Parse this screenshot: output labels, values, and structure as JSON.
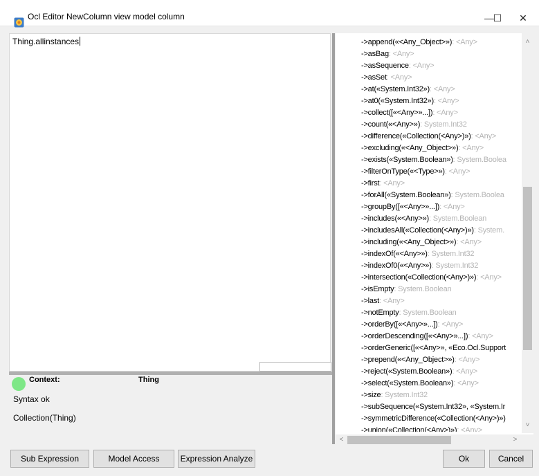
{
  "window": {
    "title": "Ocl Editor NewColumn view model column",
    "controls": {
      "minimize": "—",
      "maximize": "☐",
      "close": "✕"
    }
  },
  "editor": {
    "text": "Thing.allinstances"
  },
  "info": {
    "context_label": "Context:",
    "context_value": "Thing",
    "syntax_status": "Syntax ok",
    "result_type": "Collection(Thing)",
    "status_color": "#7ee787"
  },
  "completion": {
    "items": [
      {
        "name": "->append(«<Any_Object>»)",
        "type": "<Any>"
      },
      {
        "name": "->asBag",
        "type": "<Any>"
      },
      {
        "name": "->asSequence",
        "type": "<Any>"
      },
      {
        "name": "->asSet",
        "type": "<Any>"
      },
      {
        "name": "->at(«System.Int32»)",
        "type": "<Any>"
      },
      {
        "name": "->at0(«System.Int32»)",
        "type": "<Any>"
      },
      {
        "name": "->collect([«<Any>»...])",
        "type": "<Any>"
      },
      {
        "name": "->count(«<Any>»)",
        "type": "System.Int32"
      },
      {
        "name": "->difference(«Collection(<Any>)»)",
        "type": "<Any>"
      },
      {
        "name": "->excluding(«<Any_Object>»)",
        "type": "<Any>"
      },
      {
        "name": "->exists(«System.Boolean»)",
        "type": "System.Boolea"
      },
      {
        "name": "->filterOnType(«<Type>»)",
        "type": "<Any>"
      },
      {
        "name": "->first",
        "type": "<Any>"
      },
      {
        "name": "->forAll(«System.Boolean»)",
        "type": "System.Boolea"
      },
      {
        "name": "->groupBy([«<Any>»...])",
        "type": "<Any>"
      },
      {
        "name": "->includes(«<Any>»)",
        "type": "System.Boolean"
      },
      {
        "name": "->includesAll(«Collection(<Any>)»)",
        "type": "System."
      },
      {
        "name": "->including(«<Any_Object>»)",
        "type": "<Any>"
      },
      {
        "name": "->indexOf(«<Any>»)",
        "type": "System.Int32"
      },
      {
        "name": "->indexOf0(«<Any>»)",
        "type": "System.Int32"
      },
      {
        "name": "->intersection(«Collection(<Any>)»)",
        "type": "<Any>"
      },
      {
        "name": "->isEmpty",
        "type": "System.Boolean"
      },
      {
        "name": "->last",
        "type": "<Any>"
      },
      {
        "name": "->notEmpty",
        "type": "System.Boolean"
      },
      {
        "name": "->orderBy([«<Any>»...])",
        "type": "<Any>"
      },
      {
        "name": "->orderDescending([«<Any>»...])",
        "type": "<Any>"
      },
      {
        "name": "->orderGeneric([«<Any>», «Eco.Ocl.Support",
        "type": ""
      },
      {
        "name": "->prepend(«<Any_Object>»)",
        "type": "<Any>"
      },
      {
        "name": "->reject(«System.Boolean»)",
        "type": "<Any>"
      },
      {
        "name": "->select(«System.Boolean»)",
        "type": "<Any>"
      },
      {
        "name": "->size",
        "type": "System.Int32"
      },
      {
        "name": "->subSequence(«System.Int32», «System.Ir",
        "type": ""
      },
      {
        "name": "->symmetricDifference(«Collection(<Any>)»)",
        "type": ""
      },
      {
        "name": "->union(«Collection(<Any>)»)",
        "type": "<Any>"
      }
    ],
    "scroll": {
      "up": "˄",
      "down": "˅",
      "left": "<",
      "right": ">"
    }
  },
  "buttons": {
    "sub_expression": "Sub Expression",
    "model_access": "Model Access",
    "expression_analyze": "Expression Analyze",
    "ok": "Ok",
    "cancel": "Cancel"
  }
}
